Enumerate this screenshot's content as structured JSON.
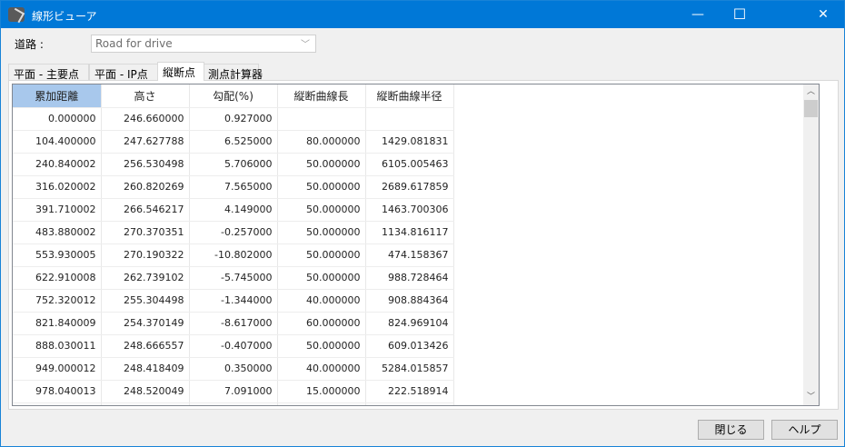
{
  "window": {
    "title": "線形ビューア",
    "minimize": "—",
    "maximize": "☐",
    "close": "✕"
  },
  "road": {
    "label": "道路 :",
    "value": "Road for drive"
  },
  "tabs": [
    {
      "label": "平面 - 主要点"
    },
    {
      "label": "平面 - IP点"
    },
    {
      "label": "縦断点"
    },
    {
      "label": "測点計算器"
    }
  ],
  "table": {
    "headers": [
      "累加距離",
      "高さ",
      "勾配(%)",
      "縦断曲線長",
      "縦断曲線半径"
    ],
    "rows": [
      [
        "0.000000",
        "246.660000",
        "0.927000",
        "",
        ""
      ],
      [
        "104.400000",
        "247.627788",
        "6.525000",
        "80.000000",
        "1429.081831"
      ],
      [
        "240.840002",
        "256.530498",
        "5.706000",
        "50.000000",
        "6105.005463"
      ],
      [
        "316.020002",
        "260.820269",
        "7.565000",
        "50.000000",
        "2689.617859"
      ],
      [
        "391.710002",
        "266.546217",
        "4.149000",
        "50.000000",
        "1463.700306"
      ],
      [
        "483.880002",
        "270.370351",
        "-0.257000",
        "50.000000",
        "1134.816117"
      ],
      [
        "553.930005",
        "270.190322",
        "-10.802000",
        "50.000000",
        "474.158367"
      ],
      [
        "622.910008",
        "262.739102",
        "-5.745000",
        "50.000000",
        "988.728464"
      ],
      [
        "752.320012",
        "255.304498",
        "-1.344000",
        "40.000000",
        "908.884364"
      ],
      [
        "821.840009",
        "254.370149",
        "-8.617000",
        "60.000000",
        "824.969104"
      ],
      [
        "888.030011",
        "248.666557",
        "-0.407000",
        "50.000000",
        "609.013426"
      ],
      [
        "949.000012",
        "248.418409",
        "0.350000",
        "40.000000",
        "5284.015857"
      ],
      [
        "978.040013",
        "248.520049",
        "7.091000",
        "15.000000",
        "222.518914"
      ],
      [
        "",
        "",
        "",
        "",
        ""
      ]
    ]
  },
  "buttons": {
    "close": "閉じる",
    "help": "ヘルプ"
  }
}
